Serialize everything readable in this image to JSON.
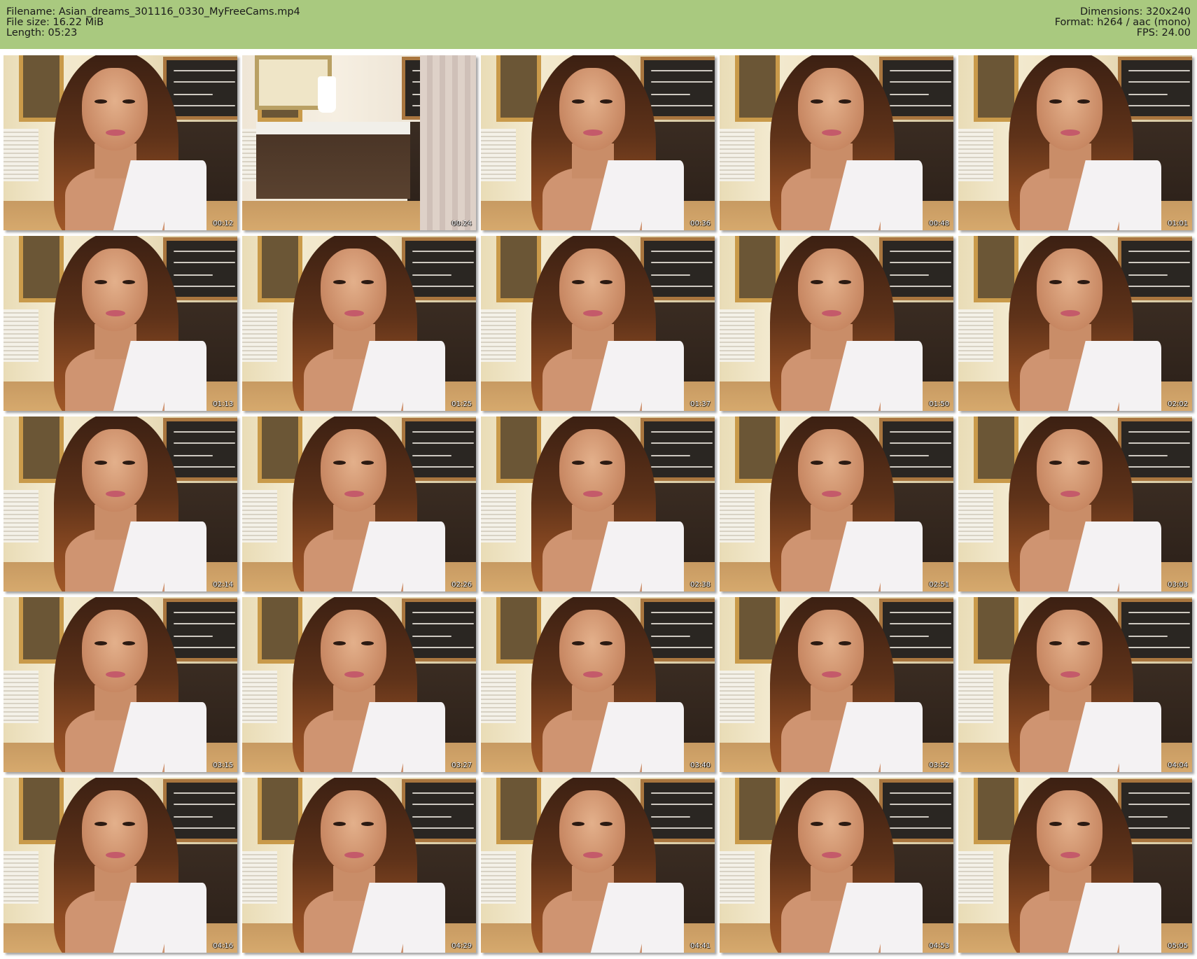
{
  "header": {
    "background_color": "#a9c97f",
    "filename": "Filename: Asian_dreams_301116_0330_MyFreeCams.mp4",
    "file_size": "File size: 16.22 MiB",
    "length": "Length: 05:23",
    "dimensions": "Dimensions: 320x240",
    "format": "Format: h264 / aac (mono)",
    "fps": "FPS: 24.00"
  },
  "thumbnails": [
    {
      "timestamp": "00:12"
    },
    {
      "timestamp": "00:24"
    },
    {
      "timestamp": "00:36"
    },
    {
      "timestamp": "00:48"
    },
    {
      "timestamp": "01:01"
    },
    {
      "timestamp": "01:13"
    },
    {
      "timestamp": "01:25"
    },
    {
      "timestamp": "01:37"
    },
    {
      "timestamp": "01:50"
    },
    {
      "timestamp": "02:02"
    },
    {
      "timestamp": "02:14"
    },
    {
      "timestamp": "02:26"
    },
    {
      "timestamp": "02:38"
    },
    {
      "timestamp": "02:51"
    },
    {
      "timestamp": "03:03"
    },
    {
      "timestamp": "03:15"
    },
    {
      "timestamp": "03:27"
    },
    {
      "timestamp": "03:40"
    },
    {
      "timestamp": "03:52"
    },
    {
      "timestamp": "04:04"
    },
    {
      "timestamp": "04:16"
    },
    {
      "timestamp": "04:29"
    },
    {
      "timestamp": "04:41"
    },
    {
      "timestamp": "04:53"
    },
    {
      "timestamp": "05:05"
    }
  ]
}
